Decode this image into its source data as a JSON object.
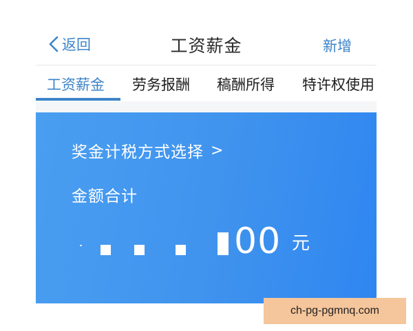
{
  "navbar": {
    "back_label": "返回",
    "title": "工资薪金",
    "add_label": "新增",
    "accent_color": "#3d84c8"
  },
  "tabs": [
    {
      "label": "工资薪金",
      "active": true
    },
    {
      "label": "劳务报酬",
      "active": false
    },
    {
      "label": "稿酬所得",
      "active": false
    },
    {
      "label": "特许权使用",
      "active": false
    }
  ],
  "card": {
    "background": "#3f93ee",
    "bonus_method_label": "奖金计税方式选择",
    "bonus_arrow": ">",
    "total_label": "金额合计",
    "amount_visible_suffix": "00",
    "amount_unit": "元"
  },
  "watermark": {
    "text": "ch-pg-pgmnq.com"
  }
}
